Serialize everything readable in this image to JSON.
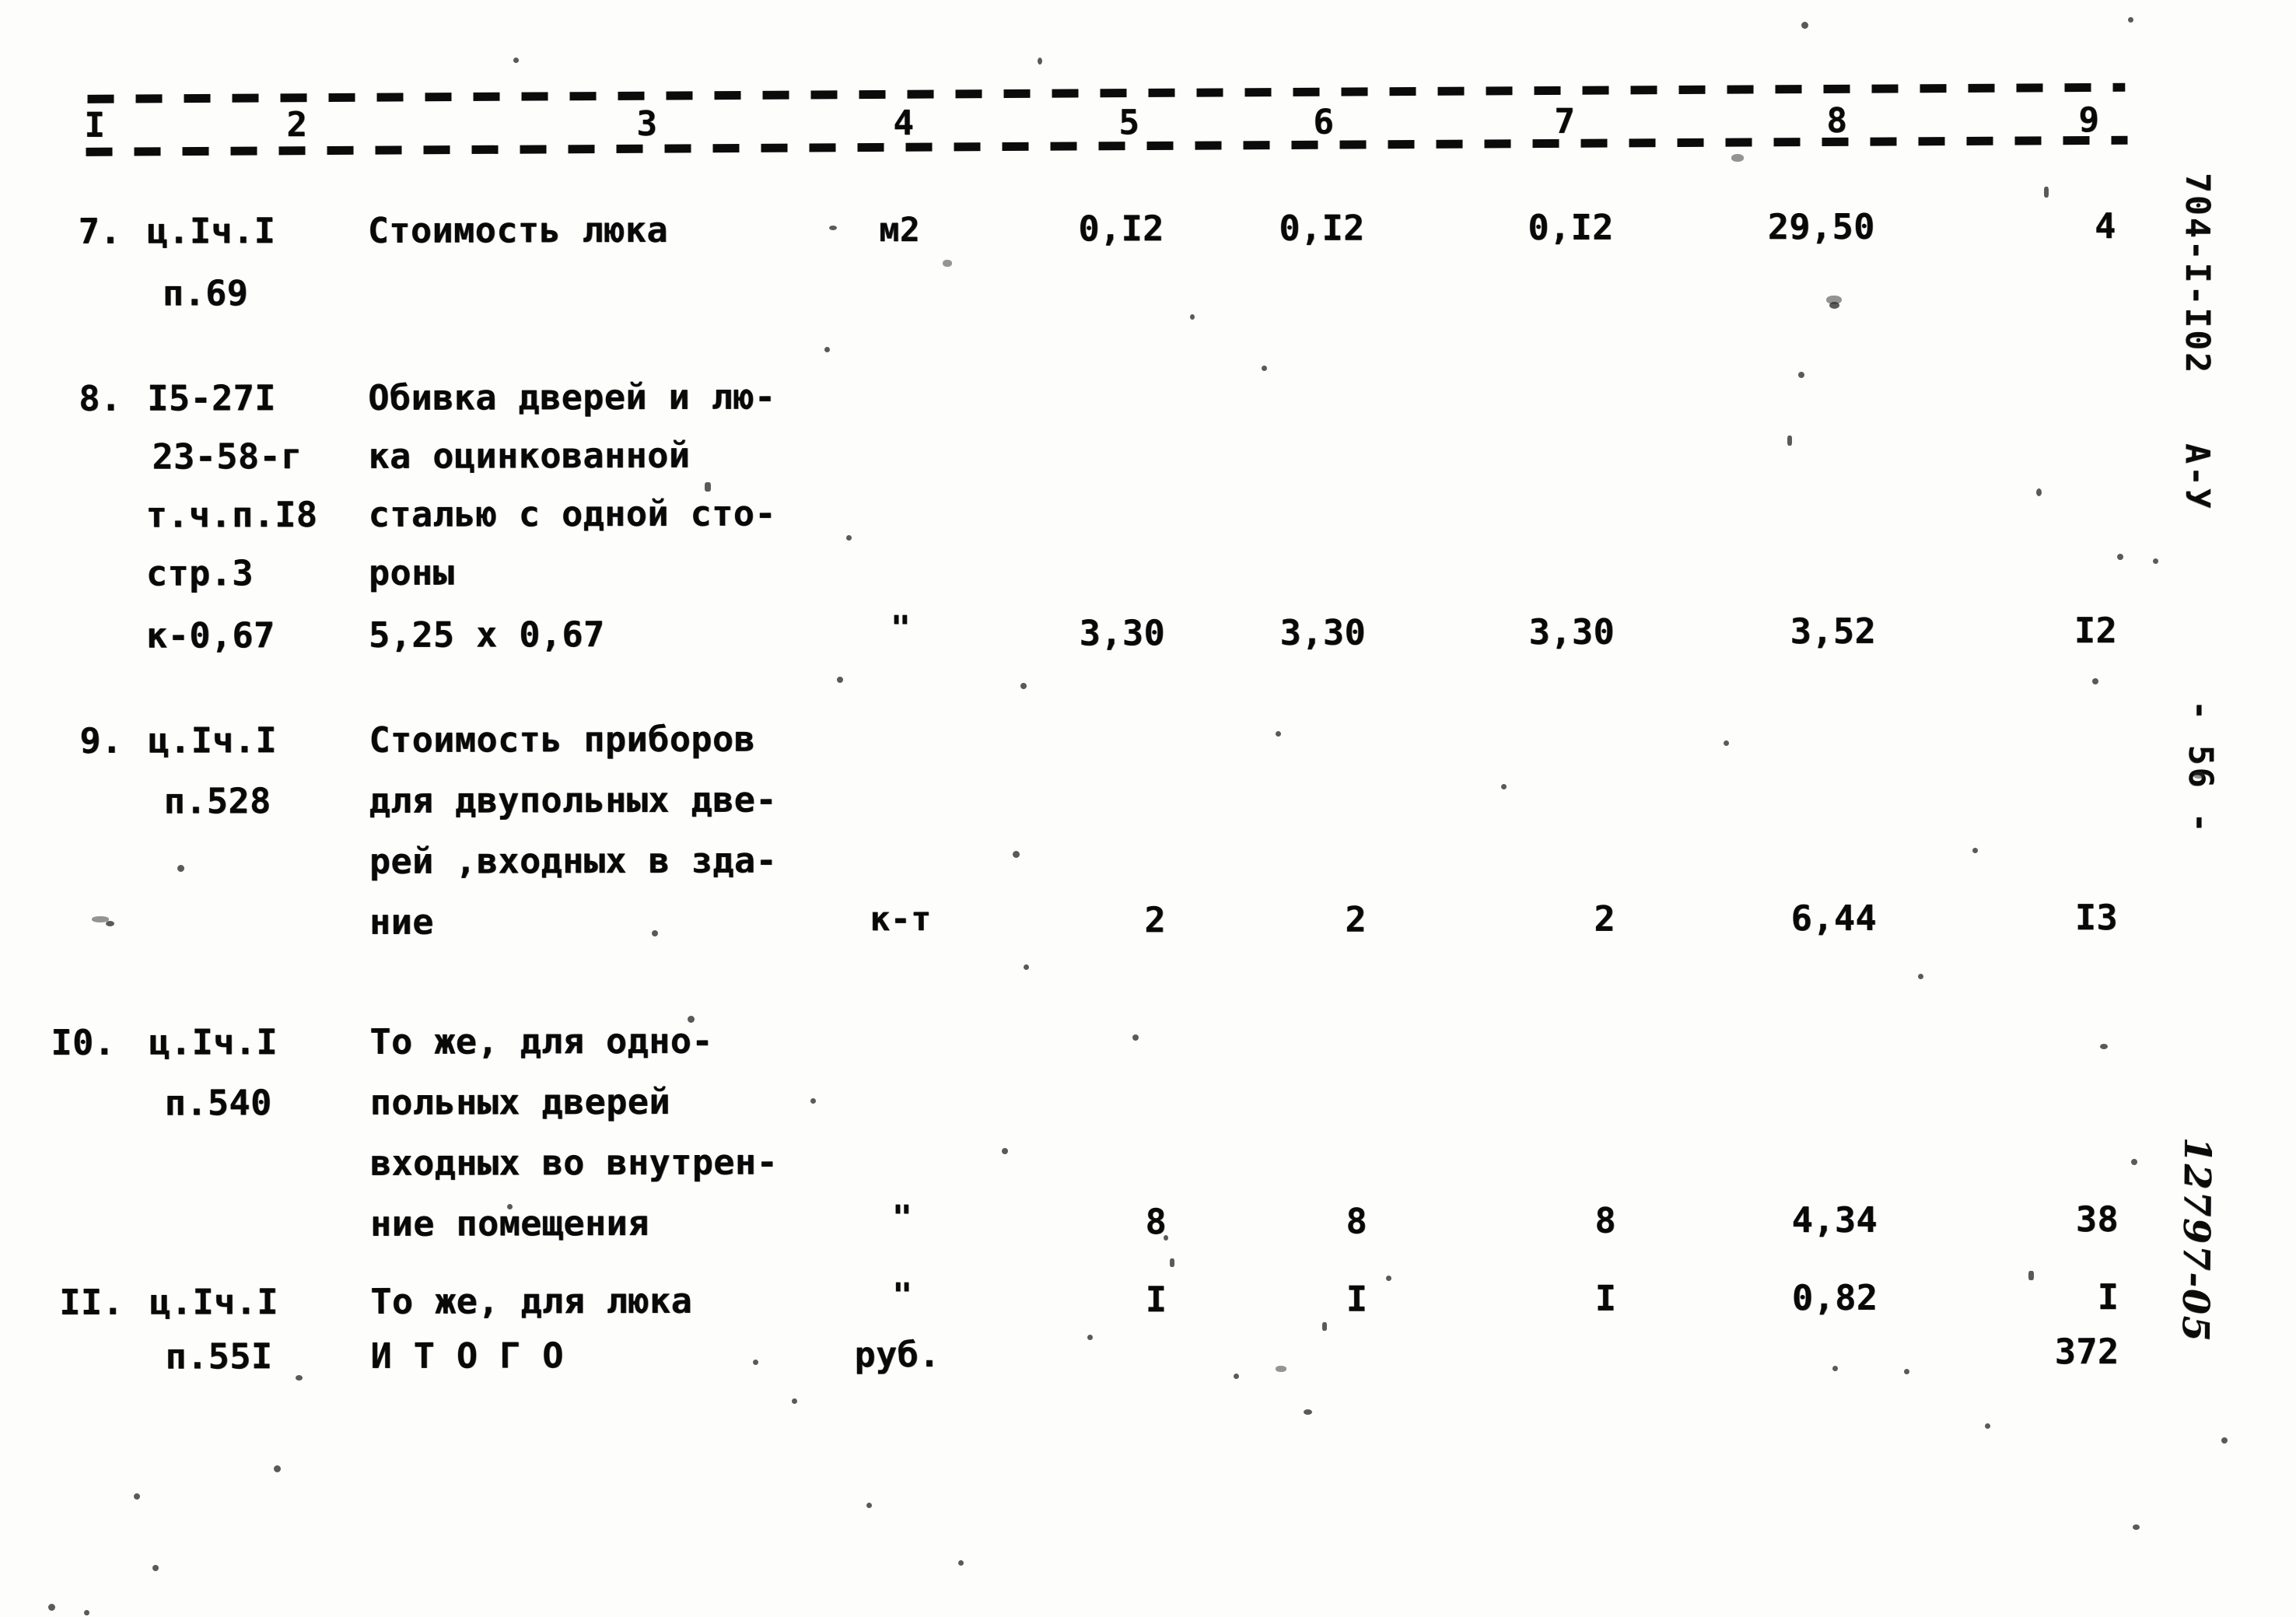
{
  "document": {
    "type": "construction-cost-estimate-table",
    "language": "ru"
  },
  "header": {
    "column_numbers": [
      "I",
      "2",
      "3",
      "4",
      "5",
      "6",
      "7",
      "8",
      "9"
    ]
  },
  "rows": [
    {
      "n": "7.",
      "code_lines": [
        "ц.Iч.I",
        "п.69"
      ],
      "desc_lines": [
        "Стоимость люка"
      ],
      "unit": "м2",
      "c5": "0,I2",
      "c6": "0,I2",
      "c7": "0,I2",
      "c8": "29,50",
      "c9": "4"
    },
    {
      "n": "8.",
      "code_lines": [
        "I5-27I",
        "23-58-г",
        "т.ч.п.I8",
        "стр.3",
        "к-0,67"
      ],
      "desc_lines": [
        "Обивка дверей и лю-",
        "ка оцинкованной",
        "сталью с одной сто-",
        "роны",
        "5,25 х 0,67"
      ],
      "unit": "\"",
      "c5": "3,30",
      "c6": "3,30",
      "c7": "3,30",
      "c8": "3,52",
      "c9": "I2"
    },
    {
      "n": "9.",
      "code_lines": [
        "ц.Iч.I",
        "п.528"
      ],
      "desc_lines": [
        "Стоимость приборов",
        "для двупольных две-",
        "рей ,входных в зда-",
        "ние"
      ],
      "unit": "к-т",
      "c5": "2",
      "c6": "2",
      "c7": "2",
      "c8": "6,44",
      "c9": "I3"
    },
    {
      "n": "I0.",
      "code_lines": [
        "ц.Iч.I",
        "п.540"
      ],
      "desc_lines": [
        "То же, для одно-",
        "польных дверей",
        "входных во внутрен-",
        "ние помещения"
      ],
      "unit": "\"",
      "c5": "8",
      "c6": "8",
      "c7": "8",
      "c8": "4,34",
      "c9": "38"
    },
    {
      "n": "II.",
      "code_lines": [
        "ц.Iч.I",
        "п.55I"
      ],
      "desc_lines": [
        "То же, для люка"
      ],
      "unit": "\"",
      "c5": "I",
      "c6": "I",
      "c7": "I",
      "c8": "0,82",
      "c9": "I"
    }
  ],
  "total": {
    "label": "И Т О Г О",
    "unit": "руб.",
    "value": "372"
  },
  "margin": {
    "doc_code": "704-I-I02",
    "series": "А-У",
    "page": "- 56 -",
    "stamp": "12797-05"
  }
}
